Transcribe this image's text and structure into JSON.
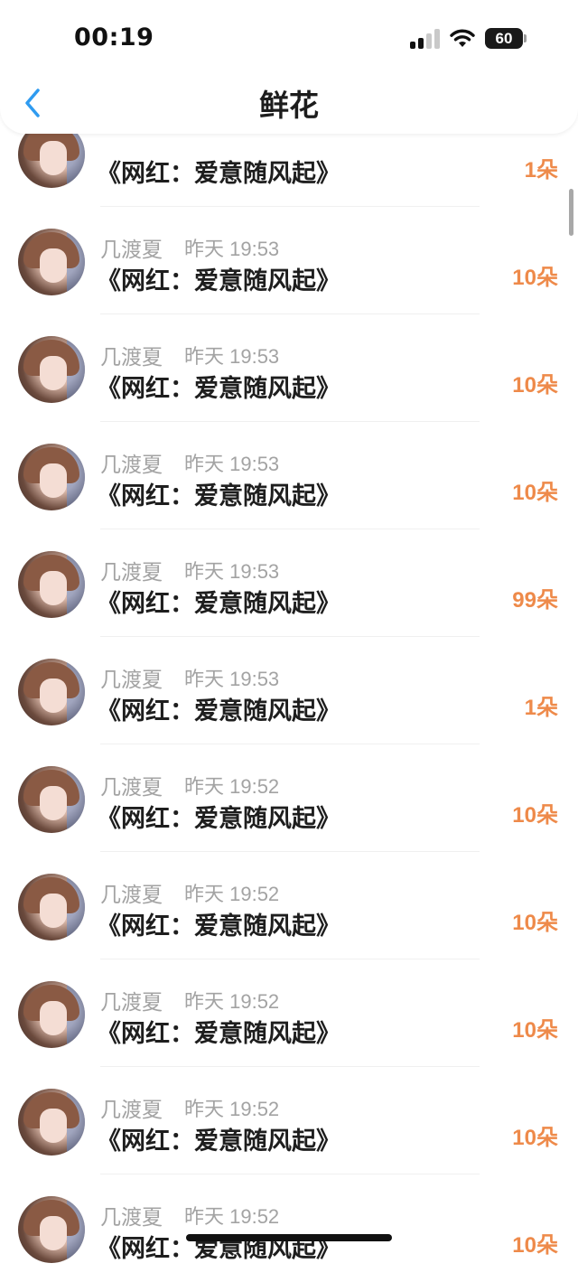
{
  "status_bar": {
    "time": "00:19",
    "battery": "60"
  },
  "nav": {
    "title": "鲜花",
    "back_icon": "chevron-left-icon"
  },
  "colors": {
    "accent_blue": "#2f9bf0",
    "count_orange": "#ee8a4a",
    "meta_gray": "#a3a3a3",
    "text_dark": "#1e1e1e"
  },
  "list": {
    "items": [
      {
        "name": "",
        "time": "",
        "gift": "《网红：爱意随风起》",
        "count": "1朵"
      },
      {
        "name": "几渡夏",
        "time": "昨天 19:53",
        "gift": "《网红：爱意随风起》",
        "count": "10朵"
      },
      {
        "name": "几渡夏",
        "time": "昨天 19:53",
        "gift": "《网红：爱意随风起》",
        "count": "10朵"
      },
      {
        "name": "几渡夏",
        "time": "昨天 19:53",
        "gift": "《网红：爱意随风起》",
        "count": "10朵"
      },
      {
        "name": "几渡夏",
        "time": "昨天 19:53",
        "gift": "《网红：爱意随风起》",
        "count": "99朵"
      },
      {
        "name": "几渡夏",
        "time": "昨天 19:53",
        "gift": "《网红：爱意随风起》",
        "count": "1朵"
      },
      {
        "name": "几渡夏",
        "time": "昨天 19:52",
        "gift": "《网红：爱意随风起》",
        "count": "10朵"
      },
      {
        "name": "几渡夏",
        "time": "昨天 19:52",
        "gift": "《网红：爱意随风起》",
        "count": "10朵"
      },
      {
        "name": "几渡夏",
        "time": "昨天 19:52",
        "gift": "《网红：爱意随风起》",
        "count": "10朵"
      },
      {
        "name": "几渡夏",
        "time": "昨天 19:52",
        "gift": "《网红：爱意随风起》",
        "count": "10朵"
      },
      {
        "name": "几渡夏",
        "time": "昨天 19:52",
        "gift": "《网红：爱意随风起》",
        "count": "10朵"
      }
    ]
  }
}
